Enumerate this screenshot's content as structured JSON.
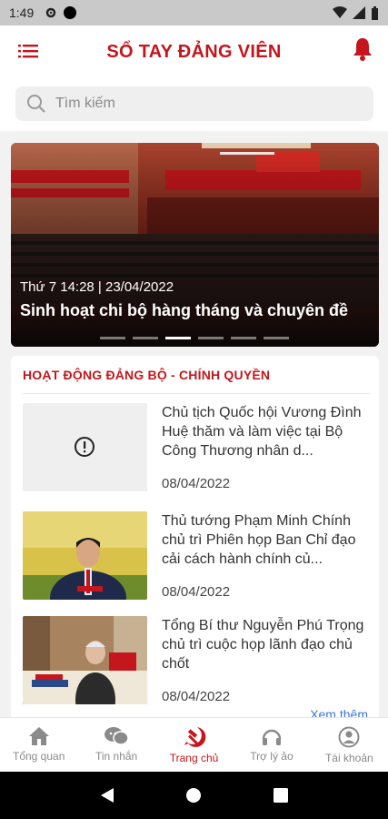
{
  "status": {
    "time": "1:49"
  },
  "header": {
    "title": "SỔ TAY ĐẢNG VIÊN"
  },
  "search": {
    "placeholder": "Tìm kiếm"
  },
  "banner": {
    "date": "Thứ 7  14:28 | 23/04/2022",
    "title": "Sinh hoạt chi bộ hàng tháng và chuyên đề",
    "slide_count": 6,
    "active_slide": 3
  },
  "section": {
    "title": "HOẠT ĐỘNG ĐẢNG BỘ - CHÍNH QUYỀN",
    "more": "Xem thêm",
    "items": [
      {
        "headline": "Chủ tịch Quốc hội Vương Đình Huệ thăm và làm việc tại Bộ Công Thương nhân d...",
        "date": "08/04/2022",
        "thumb": "error-placeholder"
      },
      {
        "headline": "Thủ tướng Phạm Minh Chính chủ trì Phiên họp Ban Chỉ đạo cải cách hành chính củ...",
        "date": "08/04/2022",
        "thumb": "photo"
      },
      {
        "headline": "Tổng Bí thư Nguyễn Phú Trọng chủ trì cuộc họp lãnh đạo chủ chốt",
        "date": "08/04/2022",
        "thumb": "photo"
      }
    ]
  },
  "nav": {
    "items": [
      {
        "label": "Tổng quan",
        "icon": "home-icon"
      },
      {
        "label": "Tin nhắn",
        "icon": "chat-icon"
      },
      {
        "label": "Trang chủ",
        "icon": "hammer-sickle-icon"
      },
      {
        "label": "Trợ lý ảo",
        "icon": "headset-icon"
      },
      {
        "label": "Tài khoản",
        "icon": "account-icon"
      }
    ],
    "active": "Trang chủ"
  },
  "colors": {
    "brand": "#c4161c",
    "link": "#3a78d8"
  }
}
